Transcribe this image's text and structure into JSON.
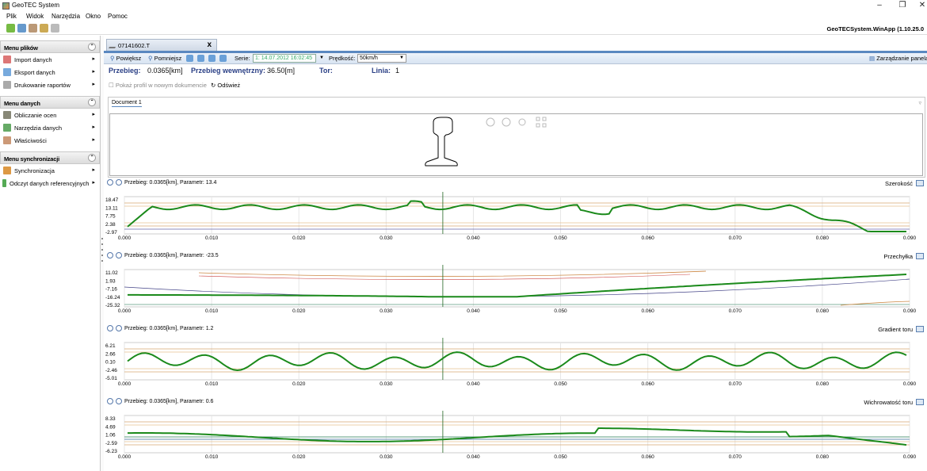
{
  "window": {
    "title": "GeoTEC System",
    "min": "–",
    "max": "❐",
    "close": "✕"
  },
  "menu": [
    "Plik",
    "Widok",
    "Narzędzia",
    "Okno",
    "Pomoc"
  ],
  "toolbar": {
    "version": "GeoTECSystem.WinApp (1.10.25.0"
  },
  "sidebar": {
    "sections": [
      {
        "title": "Menu plików",
        "items": [
          {
            "label": "Import danych",
            "icon": "import-icon",
            "color": "#d77"
          },
          {
            "label": "Eksport danych",
            "icon": "export-icon",
            "color": "#7ad"
          },
          {
            "label": "Drukowanie raportów",
            "icon": "print-icon",
            "color": "#aaa"
          }
        ]
      },
      {
        "title": "Menu danych",
        "items": [
          {
            "label": "Obliczanie ocen",
            "icon": "calc-icon",
            "color": "#887"
          },
          {
            "label": "Narzędzia danych",
            "icon": "tools-icon",
            "color": "#6a6"
          },
          {
            "label": "Właściwości",
            "icon": "properties-icon",
            "color": "#c97"
          }
        ]
      },
      {
        "title": "Menu synchronizacji",
        "items": [
          {
            "label": "Synchronizacja",
            "icon": "sync-icon",
            "color": "#d94"
          },
          {
            "label": "Odczyt danych referencyjnych",
            "icon": "reference-icon",
            "color": "#5a5"
          }
        ]
      }
    ]
  },
  "tab": {
    "label": "07141602.T",
    "close": "x"
  },
  "controls": {
    "zoom_in": "Powiększ",
    "zoom_out": "Pomniejsz",
    "serie_label": "Serie:",
    "serie_value": "1: 14.07.2012 16:02:45",
    "speed_label": "Prędkość:",
    "speed_value": "50km/h",
    "panel_mgmt": "Zarządzanie panela"
  },
  "info": {
    "przebieg_label": "Przebieg:",
    "przebieg_value": "0.0365[km]",
    "wew_label": "Przebieg wewnętrzny:",
    "wew_value": "36.50[m]",
    "tor_label": "Tor:",
    "tor_value": "",
    "linia_label": "Linia:",
    "linia_value": "1"
  },
  "options": {
    "show_profile": "Pokaż profil w nowym dokumencie",
    "refresh": "Odśwież"
  },
  "document": {
    "tab": "Document 1"
  },
  "charts": [
    {
      "name": "Szerokość",
      "header": "Przebieg: 0.0365[km],   Parametr: 13.4",
      "yticks": [
        "18.47",
        "13.11",
        "7.75",
        "2.38",
        "-2.97"
      ]
    },
    {
      "name": "Przechyłka",
      "header": "Przebieg: 0.0365[km],   Parametr: -23.5",
      "yticks": [
        "11.02",
        "1.93",
        "-7.16",
        "-16.24",
        "-25.32"
      ]
    },
    {
      "name": "Gradient toru",
      "header": "Przebieg: 0.0365[km],   Parametr: 1.2",
      "yticks": [
        "6.21",
        "2.66",
        "0.10",
        "-2.46",
        "-5.01"
      ]
    },
    {
      "name": "Wichrowatość toru",
      "header": "Przebieg: 0.0365[km],   Parametr: 0.6",
      "yticks": [
        "8.33",
        "4.69",
        "1.06",
        "-2.59",
        "-6.23"
      ]
    }
  ],
  "xticks": [
    "0.000",
    "0.010",
    "0.020",
    "0.030",
    "0.040",
    "0.050",
    "0.060",
    "0.070",
    "0.080",
    "0.090"
  ]
}
